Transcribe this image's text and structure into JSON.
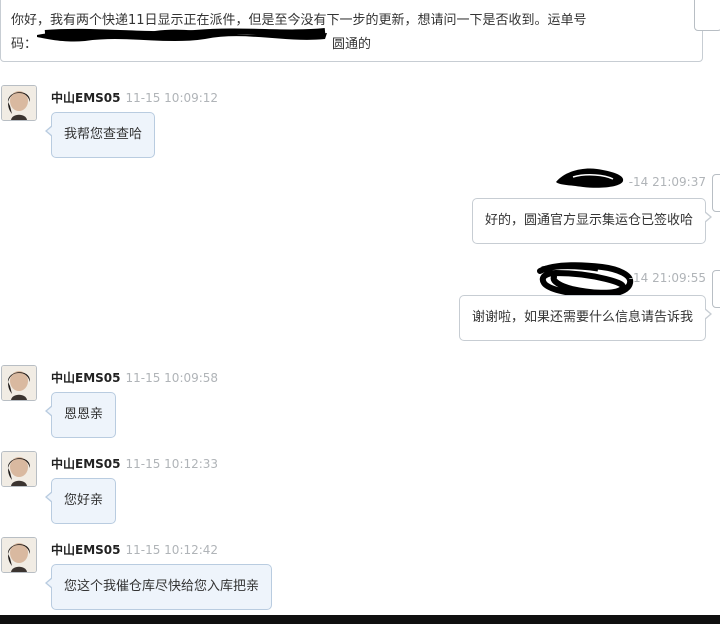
{
  "top_message": {
    "line1": "你好，我有两个快递11日显示正在派件，但是至今没有下一步的更新，想请问一下是否收到。运单号",
    "line2_prefix": "码：",
    "line2_suffix": "圆通的"
  },
  "agent": {
    "name": "中山EMS05"
  },
  "messages": [
    {
      "dir": "in",
      "time": "11-15 10:09:12",
      "text": "我帮您查查哈"
    },
    {
      "dir": "out",
      "time": "-14 21:09:37",
      "text": "好的，圆通官方显示集运仓已签收哈"
    },
    {
      "dir": "out",
      "time": "-14 21:09:55",
      "text": "谢谢啦，如果还需要什么信息请告诉我"
    },
    {
      "dir": "in",
      "time": "11-15 10:09:58",
      "text": "恩恩亲"
    },
    {
      "dir": "in",
      "time": "11-15 10:12:33",
      "text": "您好亲"
    },
    {
      "dir": "in",
      "time": "11-15 10:12:42",
      "text": "您这个我催仓库尽快给您入库把亲"
    }
  ],
  "colors": {
    "in_bubble_bg": "#eef4fb",
    "in_bubble_border": "#b9cce0",
    "out_bubble_border": "#c7cdd3",
    "timestamp": "#b0b4b8",
    "redaction": "#000000"
  },
  "icons": {
    "avatar": "agent-avatar-photo",
    "redaction": "redaction-scribble"
  }
}
